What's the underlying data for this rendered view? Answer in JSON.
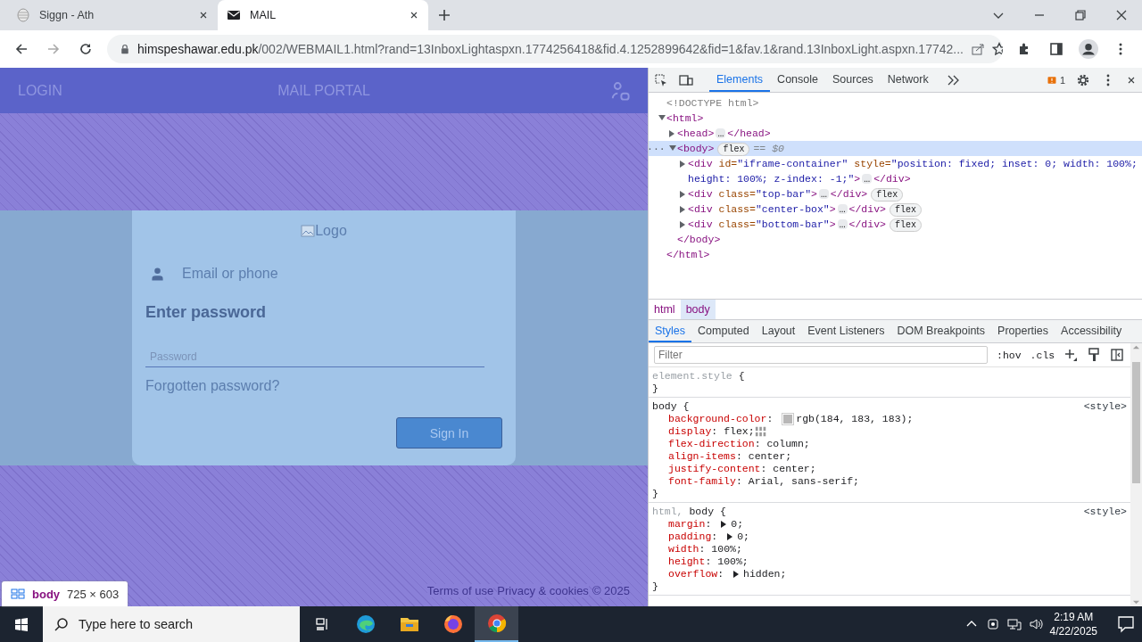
{
  "browser": {
    "tabs": [
      {
        "title": "Siggn - Ath",
        "kind": "globe",
        "selected": false
      },
      {
        "title": "MAIL",
        "kind": "mail",
        "selected": true
      }
    ],
    "address": {
      "url_host": "himspeshawar.edu.pk",
      "url_path": "/002/WEBMAIL1.html?rand=13InboxLightaspxn.1774256418&fid.4.1252899642&fid=1&fav.1&rand.13InboxLight.aspxn.17742..."
    }
  },
  "page": {
    "top_bar": {
      "left": "LOGIN",
      "center": "MAIL PORTAL"
    },
    "card": {
      "logo_alt": "Logo",
      "email_label": "Email or phone",
      "heading": "Enter password",
      "password_placeholder": "Password",
      "forgot_link": "Forgotten password?",
      "sign_in": "Sign In"
    },
    "footer": [
      "Terms of use",
      "Privacy & cookies",
      "© 2025"
    ],
    "inspect_tooltip": {
      "tag": "body",
      "size": "725 × 603"
    }
  },
  "devtools": {
    "tabs": [
      {
        "label": "Elements",
        "selected": true
      },
      {
        "label": "Console",
        "selected": false
      },
      {
        "label": "Sources",
        "selected": false
      },
      {
        "label": "Network",
        "selected": false
      }
    ],
    "issues_count": "1",
    "dom": [
      {
        "segments": [
          {
            "kind": "doctype",
            "text": "<!DOCTYPE html>"
          }
        ]
      },
      {
        "segments": [
          {
            "kind": "tag",
            "text": "<html>"
          }
        ],
        "expanded": true,
        "selected": false,
        "closing": "</html>",
        "children": [
          {
            "segments": [
              {
                "kind": "tag",
                "text": "<head>"
              },
              {
                "kind": "ellipsis",
                "text": "…"
              },
              {
                "kind": "tag",
                "text": "</head>"
              }
            ],
            "expanded": false,
            "selected": false
          },
          {
            "segments": [
              {
                "kind": "tag",
                "text": "<body>"
              },
              {
                "kind": "badge",
                "text": "flex"
              },
              {
                "kind": "marker",
                "text": "== $0"
              }
            ],
            "expanded": true,
            "selected": true,
            "gutter": "···",
            "closing": "</body>",
            "children": [
              {
                "segments": [
                  {
                    "kind": "tag",
                    "text": "<div"
                  },
                  {
                    "kind": "attr",
                    "text": " id="
                  },
                  {
                    "kind": "value",
                    "text": "\"iframe-container\""
                  },
                  {
                    "kind": "attr",
                    "text": " style="
                  },
                  {
                    "kind": "value",
                    "text": "\"position: fixed; inset: 0; width: 100%; height: 100%; z-index: -1;\""
                  },
                  {
                    "kind": "tag",
                    "text": ">"
                  },
                  {
                    "kind": "ellipsis",
                    "text": "…"
                  },
                  {
                    "kind": "tag",
                    "text": "</div>"
                  }
                ],
                "expanded": false,
                "selected": false
              },
              {
                "segments": [
                  {
                    "kind": "tag",
                    "text": "<div"
                  },
                  {
                    "kind": "attr",
                    "text": " class="
                  },
                  {
                    "kind": "value",
                    "text": "\"top-bar\""
                  },
                  {
                    "kind": "tag",
                    "text": ">"
                  },
                  {
                    "kind": "ellipsis",
                    "text": "…"
                  },
                  {
                    "kind": "tag",
                    "text": "</div>"
                  },
                  {
                    "kind": "badge",
                    "text": "flex"
                  }
                ],
                "expanded": false,
                "selected": false
              },
              {
                "segments": [
                  {
                    "kind": "tag",
                    "text": "<div"
                  },
                  {
                    "kind": "attr",
                    "text": " class="
                  },
                  {
                    "kind": "value",
                    "text": "\"center-box\""
                  },
                  {
                    "kind": "tag",
                    "text": ">"
                  },
                  {
                    "kind": "ellipsis",
                    "text": "…"
                  },
                  {
                    "kind": "tag",
                    "text": "</div>"
                  },
                  {
                    "kind": "badge",
                    "text": "flex"
                  }
                ],
                "expanded": false,
                "selected": false
              },
              {
                "segments": [
                  {
                    "kind": "tag",
                    "text": "<div"
                  },
                  {
                    "kind": "attr",
                    "text": " class="
                  },
                  {
                    "kind": "value",
                    "text": "\"bottom-bar\""
                  },
                  {
                    "kind": "tag",
                    "text": ">"
                  },
                  {
                    "kind": "ellipsis",
                    "text": "…"
                  },
                  {
                    "kind": "tag",
                    "text": "</div>"
                  },
                  {
                    "kind": "badge",
                    "text": "flex"
                  }
                ],
                "expanded": false,
                "selected": false
              }
            ]
          }
        ]
      }
    ],
    "breadcrumbs": [
      {
        "label": "html",
        "selected": false
      },
      {
        "label": "body",
        "selected": true
      }
    ],
    "sub_tabs": [
      {
        "label": "Styles",
        "selected": true
      },
      {
        "label": "Computed",
        "selected": false
      },
      {
        "label": "Layout",
        "selected": false
      },
      {
        "label": "Event Listeners",
        "selected": false
      },
      {
        "label": "DOM Breakpoints",
        "selected": false
      },
      {
        "label": "Properties",
        "selected": false
      },
      {
        "label": "Accessibility",
        "selected": false
      }
    ],
    "filter_placeholder": "Filter",
    "hov": ":hov",
    "cls": ".cls",
    "separator": ":",
    "rules": [
      {
        "selector": [
          {
            "text": "element.style",
            "matched": false
          }
        ],
        "open": "{",
        "close": "}"
      },
      {
        "selector": [
          {
            "text": "body",
            "matched": true
          }
        ],
        "open": "{",
        "close": "}",
        "source": "<style>",
        "declarations": [
          {
            "property": "background-color",
            "value": "rgb(184, 183, 183);",
            "kind": "color",
            "color": "#b8b7b7"
          },
          {
            "property": "display",
            "value": "flex;",
            "kind": "flex"
          },
          {
            "property": "flex-direction",
            "value": "column;",
            "kind": "plain"
          },
          {
            "property": "align-items",
            "value": "center;",
            "kind": "plain"
          },
          {
            "property": "justify-content",
            "value": "center;",
            "kind": "plain"
          },
          {
            "property": "font-family",
            "value": "Arial, sans-serif;",
            "kind": "plain"
          }
        ]
      },
      {
        "selector": [
          {
            "text": "html,",
            "matched": false
          },
          {
            "text": "body",
            "matched": true
          }
        ],
        "open": "{",
        "close": "}",
        "source": "<style>",
        "declarations": [
          {
            "property": "margin",
            "value": "0;",
            "kind": "expandable"
          },
          {
            "property": "padding",
            "value": "0;",
            "kind": "expandable"
          },
          {
            "property": "width",
            "value": "100%;",
            "kind": "plain"
          },
          {
            "property": "height",
            "value": "100%;",
            "kind": "plain"
          },
          {
            "property": "overflow",
            "value": "hidden;",
            "kind": "expandable"
          }
        ]
      }
    ]
  },
  "taskbar": {
    "search_placeholder": "Type here to search",
    "time": "2:19 AM",
    "date": "4/22/2025"
  }
}
